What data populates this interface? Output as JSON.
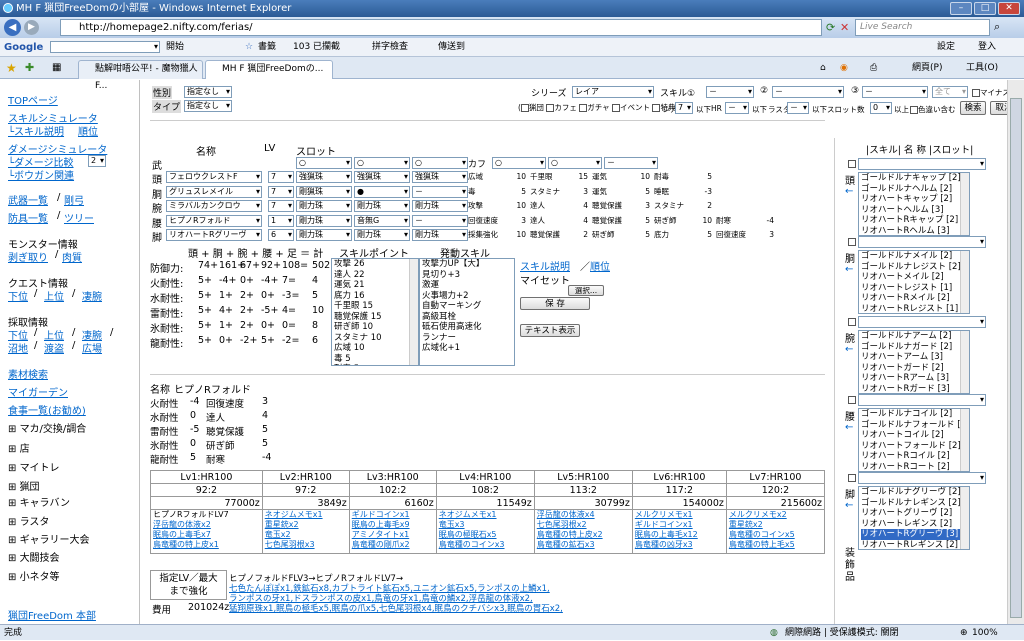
{
  "window": {
    "title": "MH F 猟団FreeDomの小部屋 - Windows Internet Explorer"
  },
  "address": {
    "url": "http://homepage2.nifty.com/ferias/",
    "search_placeholder": "Live Search"
  },
  "google_bar": {
    "brand": "Google",
    "open": "開始",
    "bookmarks": "書籤",
    "blocked": "103 已攔截",
    "spell": "拼字檢查",
    "send": "傳送到",
    "settings": "設定",
    "login": "登入"
  },
  "tabs": [
    {
      "label": "點解咁唔公平! - 魔物獵人F..."
    },
    {
      "label": "MH F 猟団FreeDomの..."
    }
  ],
  "ie_menu": {
    "page": "網頁(P)",
    "tools": "工具(O)"
  },
  "left_nav": {
    "top": "TOPページ",
    "skill_sim": "スキルシミュレータ",
    "skill_desc": "└スキル説明",
    "rank": "順位",
    "dmg_sim": "ダメージシミュレータ",
    "dmg_cmp": "└ダメージ比較",
    "dmg_cmp_val": "2",
    "bowgun": "└ボウガン関連",
    "weapons": "武器一覧",
    "rare": "剛弓",
    "armors": "防具一覧",
    "tree": "ツリー",
    "monster_info": "モンスター情報",
    "peel": "剥ぎ取り",
    "meat": "肉質",
    "quest_info": "クエスト情報",
    "low": "下位",
    "high": "上位",
    "hard": "凄腕",
    "gather_info": "採取情報",
    "g_low": "下位",
    "g_high": "上位",
    "g_hard": "凄腕",
    "g_swamp": "沼地",
    "g_desert": "渡盗",
    "g_plaza": "広場",
    "materials": "素材検索",
    "my_garden": "マイガーデン",
    "food": "食事一覧(お勧め)",
    "ex_items": [
      "マカ/交換/調合",
      "店",
      "マイトレ",
      "猟団",
      "キャラバン",
      "ラスタ",
      "ギャラリー大会",
      "大闘技会",
      "小ネタ等"
    ],
    "home": "猟団FreeDom 本部"
  },
  "filters": {
    "gender_label": "性別",
    "gender_val": "指定なし",
    "type_label": "タイプ",
    "type_val": "指定なし",
    "series_label": "シリーズ",
    "series_val": "レイア",
    "skill1_label": "スキル①",
    "skill1_val": "－",
    "skill2_val": "－",
    "skill3_label": "③",
    "skill3_val": "－",
    "all_val": "全て",
    "minus_label": "マイナス含む",
    "search_btn": "検索",
    "cancel_btn": "取消",
    "checks": [
      "猟団",
      "カフェ",
      "ガチャ",
      "イベント",
      "特典"
    ],
    "rare_label": "レア",
    "rare_val": "7",
    "below1": "以下",
    "hr_label": "HR",
    "hr_val": "－",
    "below2": "以下",
    "lasta_label": "ラスタ",
    "lasta_val": "－",
    "below3": "以下",
    "slot_label": "スロット数",
    "slot_val": "0",
    "above": "以上",
    "incl": "色違い含む"
  },
  "equip": {
    "headers": {
      "name": "名称",
      "lv": "LV",
      "slot": "スロット"
    },
    "rows": [
      {
        "part": "武",
        "name": "",
        "lv": "",
        "s1": "○",
        "s2": "○",
        "s3": "○",
        "extra": "カフ",
        "k1": "○",
        "k2": "○",
        "k3": "－",
        "skills": []
      },
      {
        "part": "頭",
        "name": "フェロウクレストF",
        "lv": "7",
        "s1": "強猟珠",
        "s2": "強猟珠",
        "s3": "強猟珠",
        "skills": [
          "広域",
          "10",
          "千里眼",
          "15",
          "運気",
          "10",
          "耐毒",
          "5"
        ]
      },
      {
        "part": "胴",
        "name": "グリュスレメイル",
        "lv": "7",
        "s1": "剛猟珠",
        "s2": "●",
        "s3": "－",
        "skills": [
          "毒",
          "5",
          "スタミナ",
          "3",
          "運気",
          "5",
          "睡眠",
          "-3"
        ]
      },
      {
        "part": "腕",
        "name": "ミラバルカンクロウ",
        "lv": "7",
        "s1": "剛力珠",
        "s2": "剛力珠",
        "s3": "剛力珠",
        "skills": [
          "攻撃",
          "10",
          "達人",
          "4",
          "聴覚保護",
          "3",
          "スタミナ",
          "2"
        ]
      },
      {
        "part": "腰",
        "name": "ヒプノRフォルド",
        "lv": "1",
        "s1": "剛力珠",
        "s2": "音無G",
        "s3": "－",
        "skills": [
          "回復速度",
          "3",
          "達人",
          "4",
          "聴覚保護",
          "5",
          "研ぎ師",
          "10",
          "耐寒",
          "-4"
        ]
      },
      {
        "part": "脚",
        "name": "リオハートRグリーヴ",
        "lv": "6",
        "s1": "剛力珠",
        "s2": "剛力珠",
        "s3": "剛力珠",
        "skills": [
          "採集強化",
          "10",
          "聴覚保護",
          "2",
          "研ぎ師",
          "5",
          "底力",
          "5",
          "回復速度",
          "3"
        ]
      }
    ],
    "sum_header": "頭 + 胴 + 腕 + 腰 + 足 ＝ 計",
    "sp_header": "スキルポイント",
    "act_header": "発動スキル",
    "def_rows": [
      {
        "label": "防御力:",
        "v": [
          "74+",
          "161+",
          "67+",
          "92+",
          "108="
        ],
        "t": "502"
      },
      {
        "label": "火耐性:",
        "v": [
          "5+",
          "-4+",
          "0+",
          "-4+",
          "7="
        ],
        "t": "4"
      },
      {
        "label": "水耐性:",
        "v": [
          "5+",
          "1+",
          "2+",
          "0+",
          "-3="
        ],
        "t": "5"
      },
      {
        "label": "雷耐性:",
        "v": [
          "5+",
          "4+",
          "2+",
          "-5+",
          "4="
        ],
        "t": "10"
      },
      {
        "label": "氷耐性:",
        "v": [
          "5+",
          "1+",
          "2+",
          "0+",
          "0="
        ],
        "t": "8"
      },
      {
        "label": "龍耐性:",
        "v": [
          "5+",
          "0+",
          "-2+",
          "5+",
          "-2="
        ],
        "t": "6"
      }
    ],
    "skill_points": [
      "攻撃 26",
      "達人 22",
      "運気 21",
      "底力 16",
      "千里眼 15",
      "聴覚保護 15",
      "研ぎ師 10",
      "スタミナ 10",
      "広域 10",
      "毒 5",
      "耐毒 5"
    ],
    "active_skills": [
      "攻撃力UP【大】",
      "見切り+3",
      "激運",
      "火事場力+2",
      "自動マーキング",
      "高級耳栓",
      "砥石使用高速化",
      "ランナー",
      "広域化+1"
    ],
    "skill_desc": "スキル説明",
    "rank": "順位",
    "myset": "マイセット",
    "myset_btn": "選択...",
    "save_btn": "保 存",
    "text_btn": "テキスト表示"
  },
  "detail": {
    "name_label": "名称",
    "name": "ヒプノRフォルド",
    "rows": [
      {
        "k": "火耐性",
        "v": "-4",
        "s": "回復速度",
        "p": "3"
      },
      {
        "k": "水耐性",
        "v": "0",
        "s": "達人",
        "p": "4"
      },
      {
        "k": "雷耐性",
        "v": "-5",
        "s": "聴覚保護",
        "p": "5"
      },
      {
        "k": "氷耐性",
        "v": "0",
        "s": "研ぎ師",
        "p": "5"
      },
      {
        "k": "龍耐性",
        "v": "5",
        "s": "耐寒",
        "p": "-4"
      }
    ]
  },
  "levels": {
    "headers": [
      "Lv1:HR100",
      "Lv2:HR100",
      "Lv3:HR100",
      "Lv4:HR100",
      "Lv5:HR100",
      "Lv6:HR100",
      "Lv7:HR100"
    ],
    "def": [
      "92:2",
      "97:2",
      "102:2",
      "108:2",
      "113:2",
      "117:2",
      "120:2"
    ],
    "cost": [
      "77000z",
      "3849z",
      "6160z",
      "11549z",
      "30799z",
      "154000z",
      "215600z"
    ],
    "mats": [
      [
        "ヒプノRフォルドLV7",
        "浮岳龍の体液x2",
        "眠鳥の上毒毛x7",
        "鳥竜種の特上皮x1"
      ],
      [
        "ネオジムメモx1",
        "重星銃x2",
        "竜玉x2",
        "七色尾羽根x3"
      ],
      [
        "ギルドコインx1",
        "眠鳥の上毒毛x9",
        "アミノタイトx1",
        "鳥竜種の剛爪x2"
      ],
      [
        "ネオジムメモx1",
        "竜玉x3",
        "眠鳥の極眠石x5",
        "鳥竜種のコインx3"
      ],
      [
        "浮岳龍の体液x4",
        "七色尾羽根x2",
        "鳥竜種の特上皮x2",
        "鳥竜種の鉱石x3"
      ],
      [
        "メルクリメモx1",
        "ギルドコインx1",
        "眠鳥の上毒毛x12",
        "鳥竜種の凶牙x3"
      ],
      [
        "メルクリメモx2",
        "重星銃x2",
        "鳥竜種のコインx5",
        "鳥竜種の特上毛x5"
      ]
    ]
  },
  "enhance": {
    "label1": "指定LV／最大",
    "label2": "まで強化",
    "cost_label": "費用",
    "cost_val": "201024z",
    "header": "ヒプノフォルドFLV3→ヒプノRフォルドLV7→",
    "lines": [
      "七色たんぽぽx1,鉄鉱石x8,カブトライト鉱石x5,ユニオン鉱石x5,ランポスの上鱗x1,",
      "ランポスの牙x1,ドスランポスの皮x1,鳥竜の牙x1,鳥竜の鱗x2,浮岳龍の体液x2,",
      "猛翔原珠x1,眠鳥の極毛x5,眠鳥の爪x5,七色尾羽根x4,眠鳥のクチバシx3,眠鳥の胃石x2,"
    ]
  },
  "right_panel": {
    "header": "|スキル| 名 称 |スロット|",
    "groups": [
      {
        "part": "頭",
        "items": [
          "ゴールドルナキャップ [2]",
          "ゴールドルナヘルム [2]",
          "リオハートキャップ [2]",
          "リオハートヘルム [3]",
          "リオハートRキャップ [2]",
          "リオハートRヘルム [3]"
        ],
        "hl": -1
      },
      {
        "part": "胴",
        "items": [
          "ゴールドルナメイル [2]",
          "ゴールドルナレジスト [2]",
          "リオハートメイル [2]",
          "リオハートレジスト [1]",
          "リオハートRメイル [2]",
          "リオハートRレジスト [1]"
        ],
        "hl": -1
      },
      {
        "part": "腕",
        "items": [
          "ゴールドルナアーム [2]",
          "ゴールドルナガード [2]",
          "リオハートアーム [3]",
          "リオハートガード [2]",
          "リオハートRアーム [3]",
          "リオハートRガード [3]"
        ],
        "hl": -1
      },
      {
        "part": "腰",
        "items": [
          "ゴールドルナコイル [2]",
          "ゴールドルナフォールド [2]",
          "リオハートコイル [2]",
          "リオハートフォールド [2]",
          "リオハートRコイル [2]",
          "リオハートRコート [2]"
        ],
        "hl": -1
      },
      {
        "part": "脚",
        "items": [
          "ゴールドルナグリーヴ [2]",
          "ゴールドルナレギンス [2]",
          "リオハートグリーヴ [2]",
          "リオハートレギンス [2]",
          "リオハートRグリーヴ [3]",
          "リオハートRレギンス [2]"
        ],
        "hl": 4
      }
    ],
    "decor_label": "装飾品"
  },
  "status": {
    "left": "完成",
    "zone": "網際網路 | 受保護模式: 關閉",
    "zoom": "100%"
  },
  "colors": {
    "link": "#0066cc",
    "title_bar": "#2b5a95",
    "highlight": "#316ac5"
  }
}
